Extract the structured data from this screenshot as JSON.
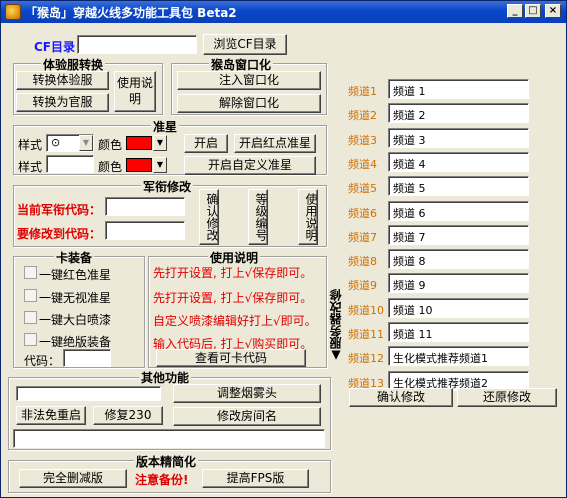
{
  "window": {
    "title": "「猴岛」穿越火线多功能工具包 Beta2",
    "min": "_",
    "max": "□",
    "close": "×"
  },
  "cf_dir": {
    "label": "CF目录",
    "value": "",
    "browse": "浏览CF目录"
  },
  "experience": {
    "title": "体验服转换",
    "to_exp": "转换体验服",
    "to_official": "转换为官服",
    "help": "使用说明"
  },
  "window_mode": {
    "title": "猴岛窗口化",
    "inject": "注入窗口化",
    "remove": "解除窗口化"
  },
  "crosshair": {
    "title": "准星",
    "style_label": "样式",
    "color_label": "颜色",
    "style1": "⊙",
    "open": "开启",
    "red_dot": "开启红点准星",
    "custom": "开启自定义准星"
  },
  "rank": {
    "title": "军衔修改",
    "current_label": "当前军衔代码：",
    "target_label": "要修改到代码：",
    "confirm": "确认修改",
    "level": "等级编号",
    "help": "使用说明"
  },
  "card": {
    "title": "卡装备",
    "items": [
      "一键红色准星",
      "一键无视准星",
      "一键大白喷漆",
      "一键绝版装备"
    ],
    "code_label": "代码："
  },
  "instructions": {
    "title": "使用说明",
    "lines": [
      "先打开设置, 打上√保存即可。",
      "先打开设置, 打上√保存即可。",
      "自定义喷漆编辑好打上√即可。",
      "输入代码后, 打上√购买即可。"
    ],
    "view_codes": "查看可卡代码"
  },
  "other": {
    "title": "其他功能",
    "smoke": "调整烟雾头",
    "restart": "非法免重启",
    "fix230": "修复230",
    "rename": "修改房间名"
  },
  "slim": {
    "title": "版本精简化",
    "delete_all": "完全删减版",
    "warning": "注意备份!",
    "fps": "提高FPS版"
  },
  "channels": {
    "side_label": "▲服务器改修",
    "items": [
      {
        "label": "频道1",
        "value": "频道 1"
      },
      {
        "label": "频道2",
        "value": "频道 2"
      },
      {
        "label": "频道3",
        "value": "频道 3"
      },
      {
        "label": "频道4",
        "value": "频道 4"
      },
      {
        "label": "频道5",
        "value": "频道 5"
      },
      {
        "label": "频道6",
        "value": "频道 6"
      },
      {
        "label": "频道7",
        "value": "频道 7"
      },
      {
        "label": "频道8",
        "value": "频道 8"
      },
      {
        "label": "频道9",
        "value": "频道 9"
      },
      {
        "label": "频道10",
        "value": "频道 10"
      },
      {
        "label": "频道11",
        "value": "频道 11"
      },
      {
        "label": "频道12",
        "value": "生化模式推荐频道1"
      },
      {
        "label": "频道13",
        "value": "生化模式推荐频道2"
      }
    ],
    "confirm": "确认修改",
    "restore": "还原修改"
  }
}
